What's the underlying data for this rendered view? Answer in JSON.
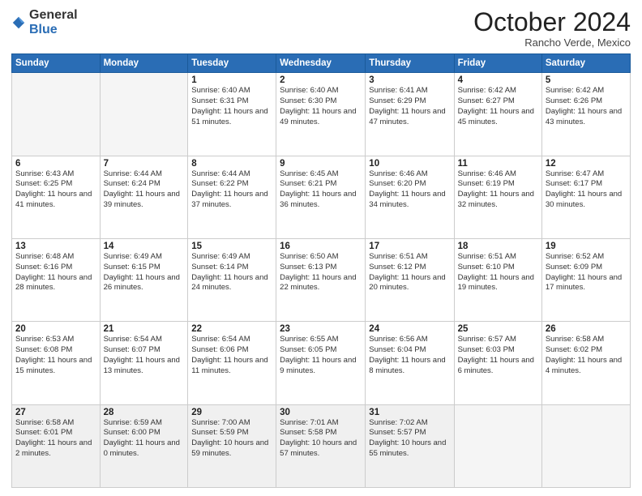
{
  "logo": {
    "general": "General",
    "blue": "Blue"
  },
  "header": {
    "month": "October 2024",
    "location": "Rancho Verde, Mexico"
  },
  "days_of_week": [
    "Sunday",
    "Monday",
    "Tuesday",
    "Wednesday",
    "Thursday",
    "Friday",
    "Saturday"
  ],
  "weeks": [
    [
      {
        "num": "",
        "detail": ""
      },
      {
        "num": "",
        "detail": ""
      },
      {
        "num": "1",
        "detail": "Sunrise: 6:40 AM\nSunset: 6:31 PM\nDaylight: 11 hours and 51 minutes."
      },
      {
        "num": "2",
        "detail": "Sunrise: 6:40 AM\nSunset: 6:30 PM\nDaylight: 11 hours and 49 minutes."
      },
      {
        "num": "3",
        "detail": "Sunrise: 6:41 AM\nSunset: 6:29 PM\nDaylight: 11 hours and 47 minutes."
      },
      {
        "num": "4",
        "detail": "Sunrise: 6:42 AM\nSunset: 6:27 PM\nDaylight: 11 hours and 45 minutes."
      },
      {
        "num": "5",
        "detail": "Sunrise: 6:42 AM\nSunset: 6:26 PM\nDaylight: 11 hours and 43 minutes."
      }
    ],
    [
      {
        "num": "6",
        "detail": "Sunrise: 6:43 AM\nSunset: 6:25 PM\nDaylight: 11 hours and 41 minutes."
      },
      {
        "num": "7",
        "detail": "Sunrise: 6:44 AM\nSunset: 6:24 PM\nDaylight: 11 hours and 39 minutes."
      },
      {
        "num": "8",
        "detail": "Sunrise: 6:44 AM\nSunset: 6:22 PM\nDaylight: 11 hours and 37 minutes."
      },
      {
        "num": "9",
        "detail": "Sunrise: 6:45 AM\nSunset: 6:21 PM\nDaylight: 11 hours and 36 minutes."
      },
      {
        "num": "10",
        "detail": "Sunrise: 6:46 AM\nSunset: 6:20 PM\nDaylight: 11 hours and 34 minutes."
      },
      {
        "num": "11",
        "detail": "Sunrise: 6:46 AM\nSunset: 6:19 PM\nDaylight: 11 hours and 32 minutes."
      },
      {
        "num": "12",
        "detail": "Sunrise: 6:47 AM\nSunset: 6:17 PM\nDaylight: 11 hours and 30 minutes."
      }
    ],
    [
      {
        "num": "13",
        "detail": "Sunrise: 6:48 AM\nSunset: 6:16 PM\nDaylight: 11 hours and 28 minutes."
      },
      {
        "num": "14",
        "detail": "Sunrise: 6:49 AM\nSunset: 6:15 PM\nDaylight: 11 hours and 26 minutes."
      },
      {
        "num": "15",
        "detail": "Sunrise: 6:49 AM\nSunset: 6:14 PM\nDaylight: 11 hours and 24 minutes."
      },
      {
        "num": "16",
        "detail": "Sunrise: 6:50 AM\nSunset: 6:13 PM\nDaylight: 11 hours and 22 minutes."
      },
      {
        "num": "17",
        "detail": "Sunrise: 6:51 AM\nSunset: 6:12 PM\nDaylight: 11 hours and 20 minutes."
      },
      {
        "num": "18",
        "detail": "Sunrise: 6:51 AM\nSunset: 6:10 PM\nDaylight: 11 hours and 19 minutes."
      },
      {
        "num": "19",
        "detail": "Sunrise: 6:52 AM\nSunset: 6:09 PM\nDaylight: 11 hours and 17 minutes."
      }
    ],
    [
      {
        "num": "20",
        "detail": "Sunrise: 6:53 AM\nSunset: 6:08 PM\nDaylight: 11 hours and 15 minutes."
      },
      {
        "num": "21",
        "detail": "Sunrise: 6:54 AM\nSunset: 6:07 PM\nDaylight: 11 hours and 13 minutes."
      },
      {
        "num": "22",
        "detail": "Sunrise: 6:54 AM\nSunset: 6:06 PM\nDaylight: 11 hours and 11 minutes."
      },
      {
        "num": "23",
        "detail": "Sunrise: 6:55 AM\nSunset: 6:05 PM\nDaylight: 11 hours and 9 minutes."
      },
      {
        "num": "24",
        "detail": "Sunrise: 6:56 AM\nSunset: 6:04 PM\nDaylight: 11 hours and 8 minutes."
      },
      {
        "num": "25",
        "detail": "Sunrise: 6:57 AM\nSunset: 6:03 PM\nDaylight: 11 hours and 6 minutes."
      },
      {
        "num": "26",
        "detail": "Sunrise: 6:58 AM\nSunset: 6:02 PM\nDaylight: 11 hours and 4 minutes."
      }
    ],
    [
      {
        "num": "27",
        "detail": "Sunrise: 6:58 AM\nSunset: 6:01 PM\nDaylight: 11 hours and 2 minutes."
      },
      {
        "num": "28",
        "detail": "Sunrise: 6:59 AM\nSunset: 6:00 PM\nDaylight: 11 hours and 0 minutes."
      },
      {
        "num": "29",
        "detail": "Sunrise: 7:00 AM\nSunset: 5:59 PM\nDaylight: 10 hours and 59 minutes."
      },
      {
        "num": "30",
        "detail": "Sunrise: 7:01 AM\nSunset: 5:58 PM\nDaylight: 10 hours and 57 minutes."
      },
      {
        "num": "31",
        "detail": "Sunrise: 7:02 AM\nSunset: 5:57 PM\nDaylight: 10 hours and 55 minutes."
      },
      {
        "num": "",
        "detail": ""
      },
      {
        "num": "",
        "detail": ""
      }
    ]
  ]
}
